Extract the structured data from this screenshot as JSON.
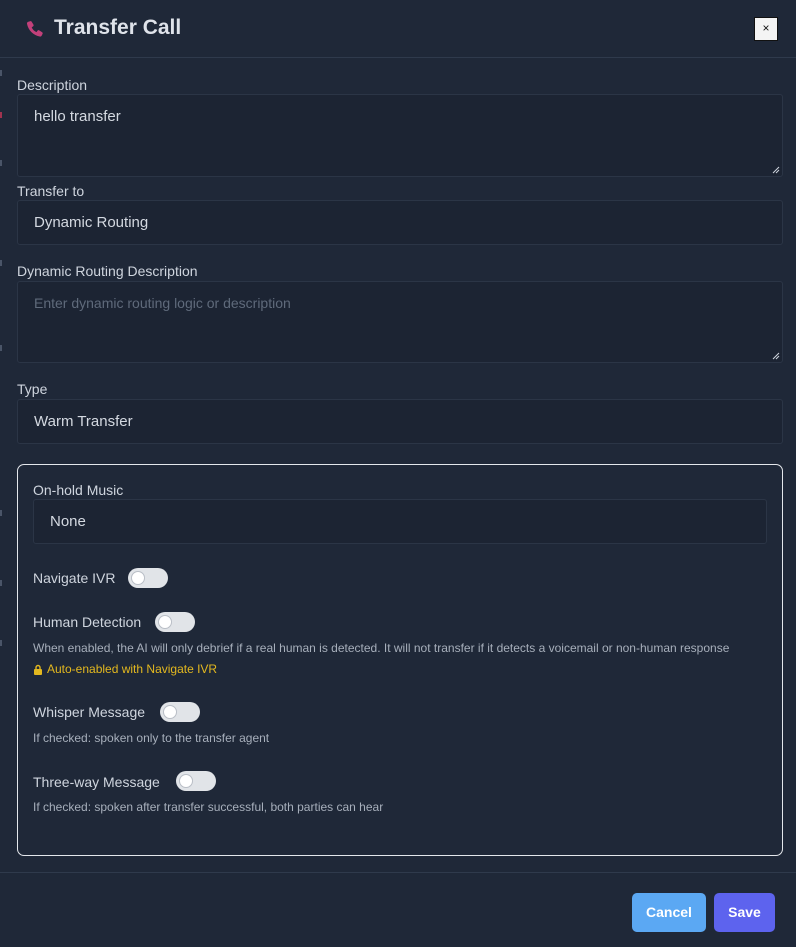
{
  "header": {
    "title": "Transfer Call",
    "close_label": "×"
  },
  "description": {
    "label": "Description",
    "value": "hello transfer"
  },
  "transfer_to": {
    "label": "Transfer to",
    "value": "Dynamic Routing"
  },
  "dynamic_routing": {
    "label": "Dynamic Routing Description",
    "placeholder": "Enter dynamic routing logic or description",
    "value": ""
  },
  "type": {
    "label": "Type",
    "value": "Warm Transfer"
  },
  "panel": {
    "on_hold_music": {
      "label": "On-hold Music",
      "value": "None"
    },
    "navigate_ivr": {
      "label": "Navigate IVR",
      "enabled": false
    },
    "human_detection": {
      "label": "Human Detection",
      "enabled": false,
      "hint": "When enabled, the AI will only debrief if a real human is detected. It will not transfer if it detects a voicemail or non-human response",
      "warning": "Auto-enabled with Navigate IVR"
    },
    "whisper_message": {
      "label": "Whisper Message",
      "enabled": false,
      "hint": "If checked: spoken only to the transfer agent"
    },
    "three_way_message": {
      "label": "Three-way Message",
      "enabled": false,
      "hint": "If checked: spoken after transfer successful, both parties can hear"
    }
  },
  "footer": {
    "cancel_label": "Cancel",
    "save_label": "Save"
  },
  "colors": {
    "accent": "#5d63ee",
    "cancel": "#5ba8f3",
    "warning": "#e3b81f",
    "phone_icon": "#c2407a"
  }
}
